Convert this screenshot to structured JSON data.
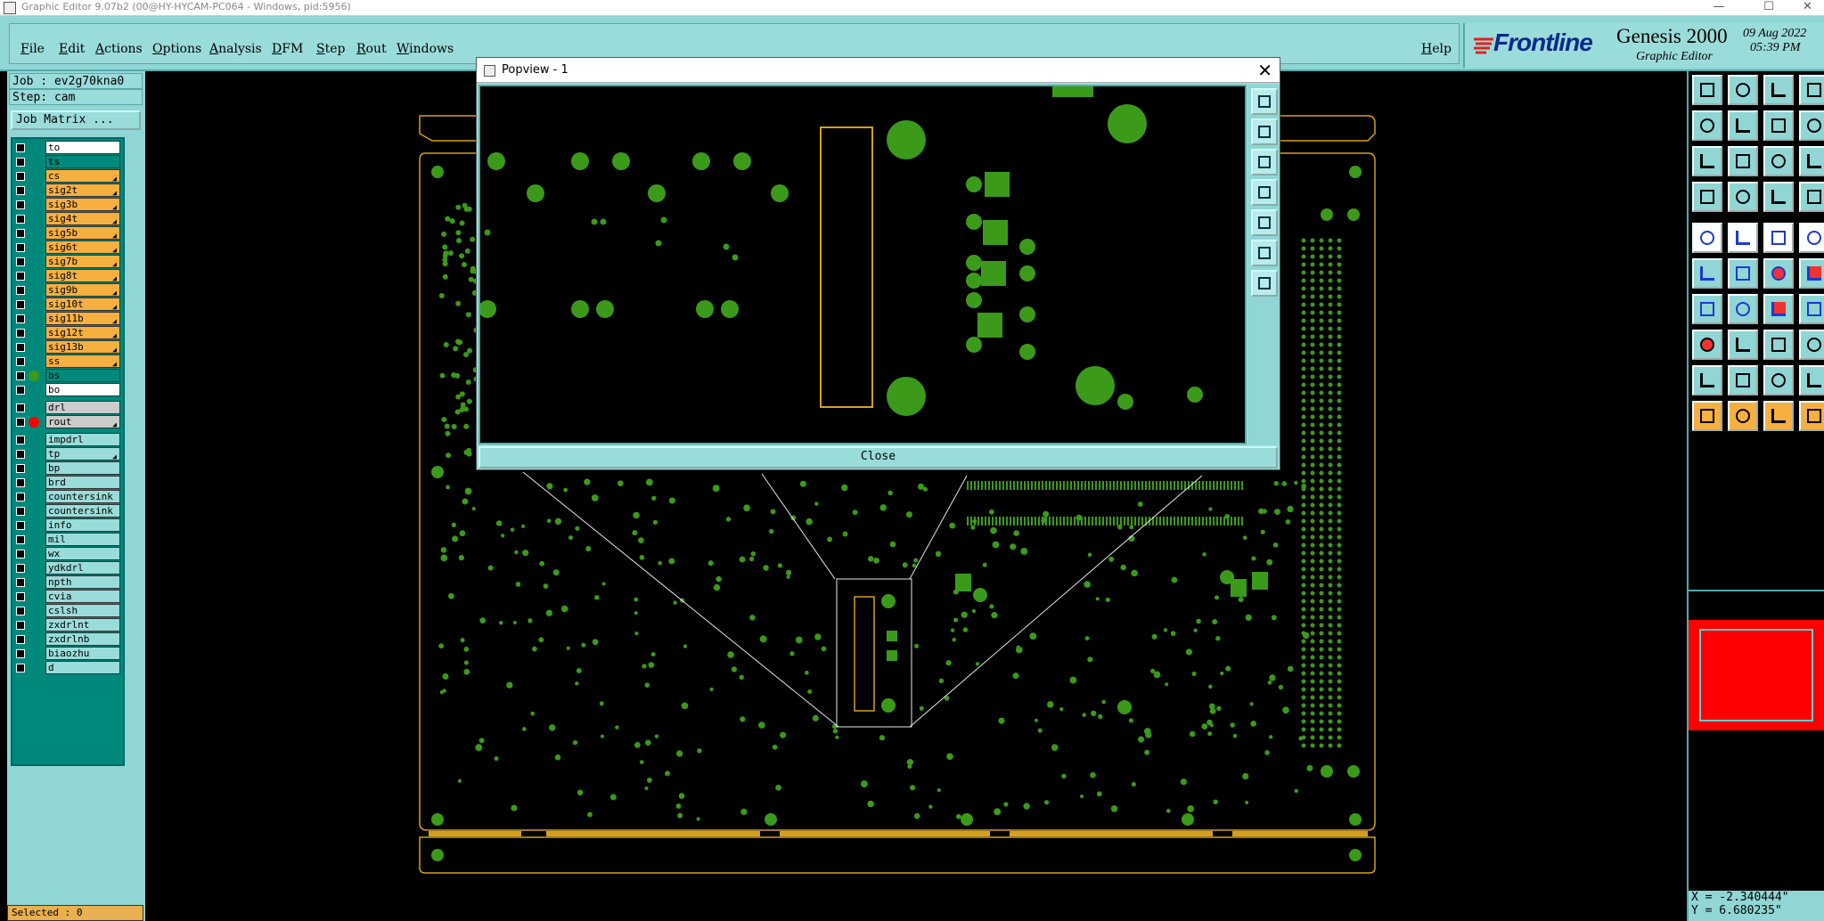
{
  "window": {
    "title": "Graphic Editor 9.07b2 (00@HY-HYCAM-PC064 - Windows, pid:5956)",
    "min_glyph": "—",
    "max_glyph": "☐",
    "close_glyph": "✕"
  },
  "menu": {
    "items": [
      "File",
      "Edit",
      "Actions",
      "Options",
      "Analysis",
      "DFM",
      "Step",
      "Rout",
      "Windows"
    ],
    "help": "Help"
  },
  "brand": {
    "logo": "Frontline",
    "product": "Genesis 2000",
    "subtitle": "Graphic Editor",
    "date": "09 Aug 2022",
    "time": "05:39 PM"
  },
  "job": {
    "job_label": "Job : ev2g70kna0",
    "step_label": "Step: cam",
    "matrix_button": "Job Matrix ..."
  },
  "layers": [
    {
      "name": "to",
      "color": "#ffffff",
      "active": false
    },
    {
      "name": "ts",
      "color": "#00897b",
      "active": false
    },
    {
      "name": "cs",
      "color": "#f5b040",
      "active": false,
      "mark": true
    },
    {
      "name": "sig2t",
      "color": "#f5b040",
      "mark": true
    },
    {
      "name": "sig3b",
      "color": "#f5b040",
      "mark": true
    },
    {
      "name": "sig4t",
      "color": "#f5b040",
      "mark": true
    },
    {
      "name": "sig5b",
      "color": "#f5b040",
      "mark": true
    },
    {
      "name": "sig6t",
      "color": "#f5b040",
      "mark": true
    },
    {
      "name": "sig7b",
      "color": "#f5b040",
      "mark": true
    },
    {
      "name": "sig8t",
      "color": "#f5b040",
      "mark": true
    },
    {
      "name": "sig9b",
      "color": "#f5b040",
      "mark": true
    },
    {
      "name": "sig10t",
      "color": "#f5b040",
      "mark": true
    },
    {
      "name": "sig11b",
      "color": "#f5b040",
      "mark": true
    },
    {
      "name": "sig12t",
      "color": "#f5b040",
      "mark": true
    },
    {
      "name": "sig13b",
      "color": "#f5b040",
      "mark": true
    },
    {
      "name": "ss",
      "color": "#f5b040",
      "mark": true
    },
    {
      "name": "bs",
      "color": "#00897b",
      "dot": "#3c9a1a"
    },
    {
      "name": "bo",
      "color": "#ffffff"
    },
    {
      "name": "drl",
      "color": "#cccccc",
      "gap": true
    },
    {
      "name": "rout",
      "color": "#cccccc",
      "dot": "#ff0000",
      "mark": true,
      "active": true
    },
    {
      "name": "impdrl",
      "color": "#9adcda",
      "gap": true
    },
    {
      "name": "tp",
      "color": "#9adcda",
      "mark": true
    },
    {
      "name": "bp",
      "color": "#9adcda"
    },
    {
      "name": "brd",
      "color": "#9adcda"
    },
    {
      "name": "countersink",
      "color": "#9adcda"
    },
    {
      "name": "countersink",
      "color": "#9adcda"
    },
    {
      "name": "info",
      "color": "#9adcda"
    },
    {
      "name": "mil",
      "color": "#9adcda"
    },
    {
      "name": "wx",
      "color": "#9adcda"
    },
    {
      "name": "ydkdrl",
      "color": "#9adcda"
    },
    {
      "name": "npth",
      "color": "#9adcda"
    },
    {
      "name": "cvia",
      "color": "#9adcda"
    },
    {
      "name": "cslsh",
      "color": "#9adcda"
    },
    {
      "name": "zxdrlnt",
      "color": "#9adcda"
    },
    {
      "name": "zxdrlnb",
      "color": "#9adcda"
    },
    {
      "name": "biaozhu",
      "color": "#9adcda"
    },
    {
      "name": "d",
      "color": "#9adcda"
    }
  ],
  "status": {
    "selected": "Selected : 0"
  },
  "popview": {
    "title": "Popview - 1",
    "close_button": "Close",
    "close_glyph": "✕"
  },
  "coordinates": {
    "x": "X = -2.340444\"",
    "y": "Y = 6.680235\""
  },
  "colors": {
    "panel": "#8fd6d4",
    "feature": "#3c9a1a",
    "outline": "#d4a020",
    "active_layer": "#f5b040"
  }
}
